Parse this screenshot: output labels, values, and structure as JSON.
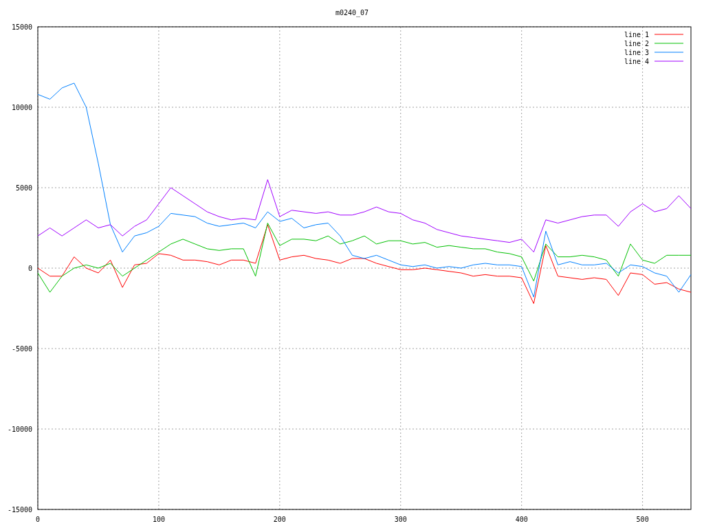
{
  "chart_data": {
    "type": "line",
    "title": "m0240_07",
    "x": [
      0,
      10,
      20,
      30,
      40,
      50,
      60,
      70,
      80,
      90,
      100,
      110,
      120,
      130,
      140,
      150,
      160,
      170,
      180,
      190,
      200,
      210,
      220,
      230,
      240,
      250,
      260,
      270,
      280,
      290,
      300,
      310,
      320,
      330,
      340,
      350,
      360,
      370,
      380,
      390,
      400,
      410,
      420,
      430,
      440,
      450,
      460,
      470,
      480,
      490,
      500,
      510,
      520,
      530,
      540
    ],
    "series": [
      {
        "name": "line 1",
        "color": "#ff0000",
        "values": [
          0,
          -500,
          -500,
          700,
          0,
          -300,
          500,
          -1200,
          200,
          300,
          900,
          800,
          500,
          500,
          400,
          200,
          500,
          500,
          300,
          2700,
          500,
          700,
          800,
          600,
          500,
          300,
          600,
          600,
          300,
          100,
          -100,
          -100,
          0,
          -100,
          -200,
          -300,
          -500,
          -400,
          -500,
          -500,
          -600,
          -2200,
          1400,
          -500,
          -600,
          -700,
          -600,
          -700,
          -1700,
          -300,
          -400,
          -1000,
          -900,
          -1300,
          -1500
        ]
      },
      {
        "name": "line 2",
        "color": "#00c000",
        "values": [
          -300,
          -1500,
          -500,
          0,
          200,
          0,
          300,
          -500,
          0,
          500,
          1000,
          1500,
          1800,
          1500,
          1200,
          1100,
          1200,
          1200,
          -500,
          2800,
          1400,
          1800,
          1800,
          1700,
          2000,
          1500,
          1700,
          2000,
          1500,
          1700,
          1700,
          1500,
          1600,
          1300,
          1400,
          1300,
          1200,
          1200,
          1000,
          900,
          700,
          -800,
          1500,
          700,
          700,
          800,
          700,
          500,
          -500,
          1500,
          500,
          300,
          800,
          800,
          800
        ]
      },
      {
        "name": "line 3",
        "color": "#0080ff",
        "values": [
          10800,
          10500,
          11200,
          11500,
          10000,
          6500,
          2700,
          1000,
          2000,
          2200,
          2600,
          3400,
          3300,
          3200,
          2800,
          2600,
          2700,
          2800,
          2500,
          3500,
          2900,
          3100,
          2500,
          2700,
          2800,
          2000,
          800,
          600,
          800,
          500,
          200,
          100,
          200,
          0,
          100,
          0,
          200,
          300,
          200,
          200,
          100,
          -1800,
          2300,
          200,
          400,
          200,
          200,
          300,
          -300,
          200,
          100,
          -300,
          -500,
          -1500,
          -400
        ]
      },
      {
        "name": "line 4",
        "color": "#a000ff",
        "values": [
          2000,
          2500,
          2000,
          2500,
          3000,
          2500,
          2700,
          2000,
          2600,
          3000,
          4000,
          5000,
          4500,
          4000,
          3500,
          3200,
          3000,
          3100,
          3000,
          5500,
          3200,
          3600,
          3500,
          3400,
          3500,
          3300,
          3300,
          3500,
          3800,
          3500,
          3400,
          3000,
          2800,
          2400,
          2200,
          2000,
          1900,
          1800,
          1700,
          1600,
          1800,
          1000,
          3000,
          2800,
          3000,
          3200,
          3300,
          3300,
          2600,
          3500,
          4000,
          3500,
          3700,
          4500,
          3700
        ]
      }
    ],
    "xlim": [
      0,
      540
    ],
    "ylim": [
      -15000,
      15000
    ],
    "xticks": [
      0,
      100,
      200,
      300,
      400,
      500
    ],
    "yticks": [
      -15000,
      -10000,
      -5000,
      0,
      5000,
      10000,
      15000
    ],
    "grid": true,
    "legend": true
  }
}
